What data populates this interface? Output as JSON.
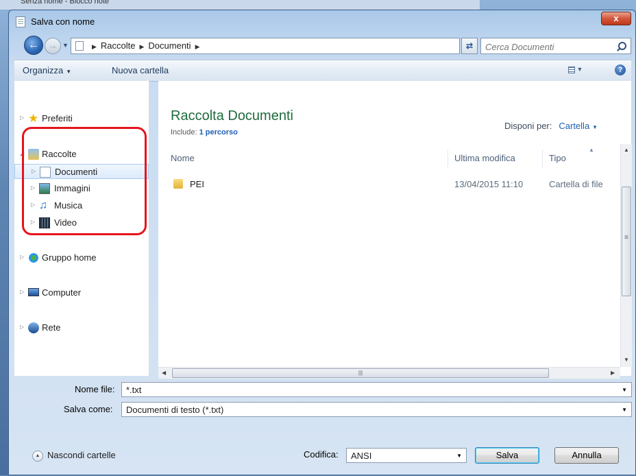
{
  "background": {
    "window_title": "Senza nome - Blocco note"
  },
  "dialog": {
    "title": "Salva con nome",
    "close_label": "x"
  },
  "navbar": {
    "breadcrumb": [
      "Raccolte",
      "Documenti"
    ],
    "search_placeholder": "Cerca Documenti"
  },
  "toolbar": {
    "organize_label": "Organizza",
    "new_folder_label": "Nuova cartella"
  },
  "nav_pane": {
    "favorites": "Preferiti",
    "libraries": "Raccolte",
    "library_items": [
      "Documenti",
      "Immagini",
      "Musica",
      "Video"
    ],
    "homegroup": "Gruppo home",
    "computer": "Computer",
    "network": "Rete"
  },
  "content": {
    "title": "Raccolta Documenti",
    "include_label": "Include:",
    "include_link": "1 percorso",
    "arrange_label": "Disponi per:",
    "arrange_value": "Cartella",
    "columns": [
      "Nome",
      "Ultima modifica",
      "Tipo"
    ],
    "files": [
      {
        "name": "PEI",
        "modified": "13/04/2015 11:10",
        "type": "Cartella di file"
      }
    ]
  },
  "form": {
    "filename_label": "Nome file:",
    "filename_value": "*.txt",
    "savetype_label": "Salva come:",
    "savetype_value": "Documenti di testo (*.txt)",
    "hide_folders_label": "Nascondi cartelle",
    "encoding_label": "Codifica:",
    "encoding_value": "ANSI",
    "save_label": "Salva",
    "cancel_label": "Annulla"
  },
  "colors": {
    "highlight_ring": "#e5141c",
    "library_title": "#1e6b3c",
    "link": "#1e5fb4"
  }
}
